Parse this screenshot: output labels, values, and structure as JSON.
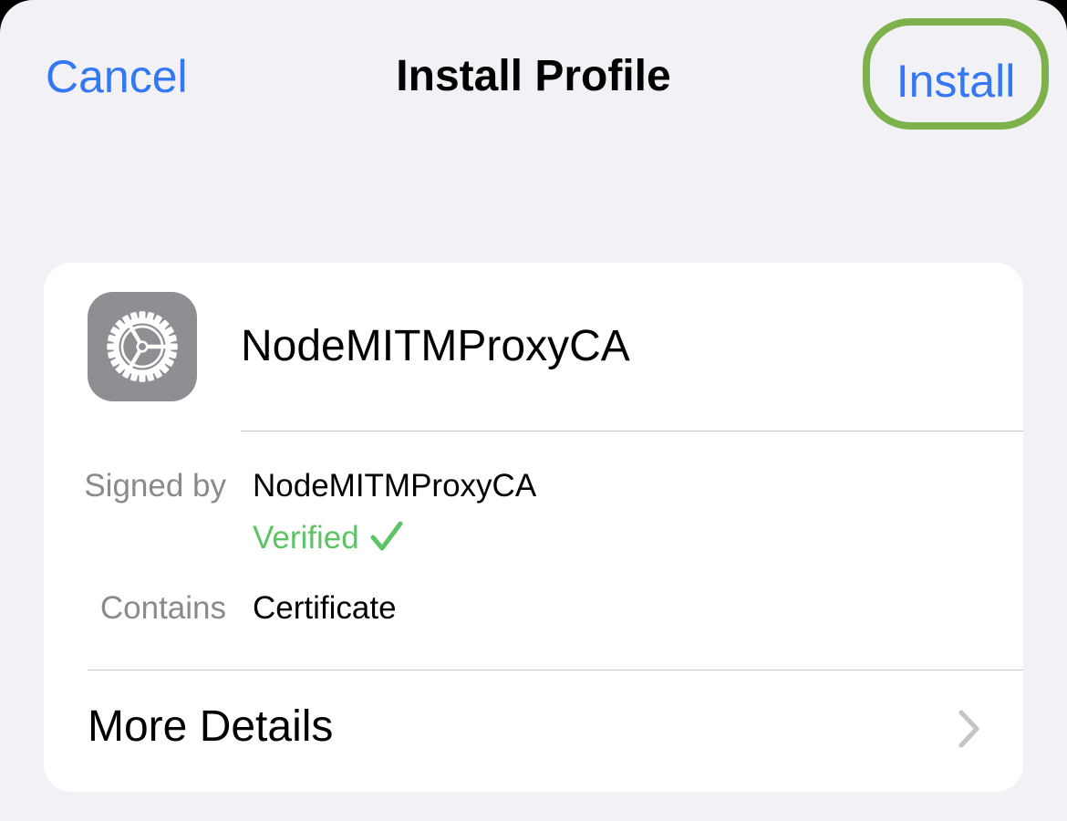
{
  "nav": {
    "cancel_label": "Cancel",
    "title": "Install Profile",
    "install_label": "Install"
  },
  "profile": {
    "name": "NodeMITMProxyCA",
    "icon": "settings-gear-icon"
  },
  "details": {
    "signed_by_label": "Signed by",
    "signed_by_value": "NodeMITMProxyCA",
    "verified_label": "Verified",
    "contains_label": "Contains",
    "contains_value": "Certificate"
  },
  "more_details_label": "More Details",
  "colors": {
    "accent": "#3478f6",
    "highlight_ring": "#7db14b",
    "verified": "#5ec365",
    "secondary_text": "#8a8a8e",
    "icon_tile": "#8e8e93",
    "chevron": "#c4c4c7",
    "background": "#f2f1f6",
    "card": "#ffffff"
  }
}
